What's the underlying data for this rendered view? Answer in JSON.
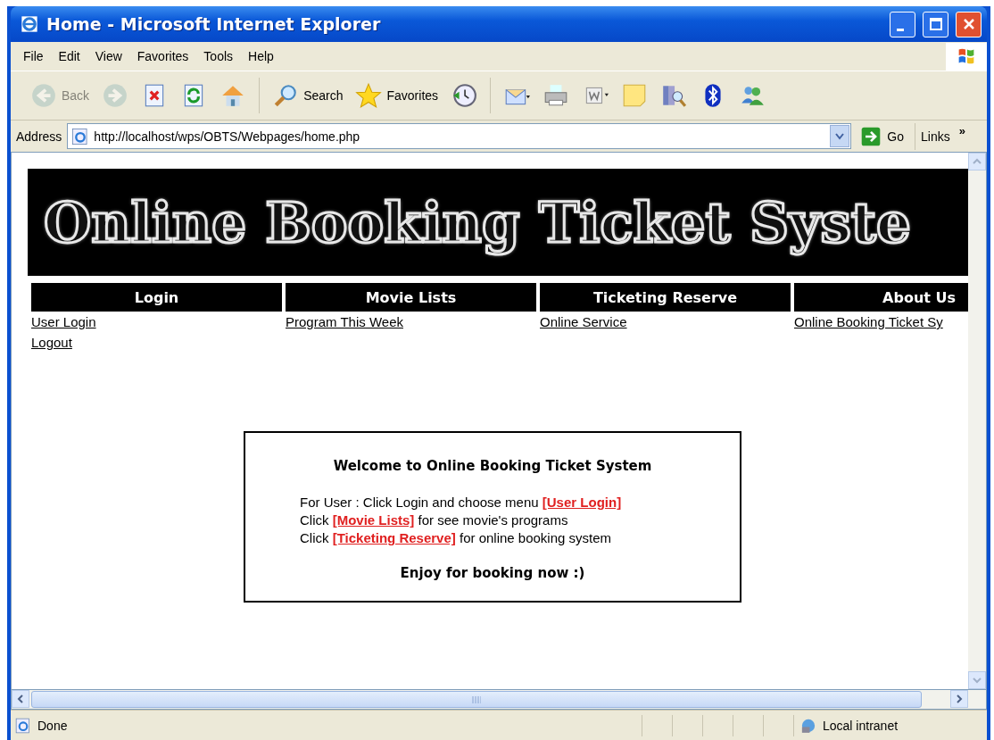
{
  "window": {
    "title": "Home - Microsoft Internet Explorer"
  },
  "menu": [
    "File",
    "Edit",
    "View",
    "Favorites",
    "Tools",
    "Help"
  ],
  "toolbar": [
    {
      "kind": "back",
      "label": "Back",
      "disabled": true
    },
    {
      "kind": "forward",
      "disabled": true
    },
    {
      "kind": "stop",
      "disabled": false
    },
    {
      "kind": "refresh",
      "disabled": false
    },
    {
      "kind": "home",
      "disabled": false
    },
    {
      "kind": "search",
      "label": "Search",
      "disabled": false
    },
    {
      "kind": "favorites",
      "label": "Favorites",
      "disabled": false
    },
    {
      "kind": "history",
      "disabled": false
    },
    {
      "kind": "mail",
      "disabled": false
    },
    {
      "kind": "print",
      "disabled": false
    },
    {
      "kind": "word",
      "disabled": false
    },
    {
      "kind": "note",
      "disabled": false
    },
    {
      "kind": "research",
      "disabled": false
    },
    {
      "kind": "bluetooth",
      "disabled": false
    },
    {
      "kind": "messenger",
      "disabled": false
    }
  ],
  "address": {
    "label": "Address",
    "url": "http://localhost/wps/OBTS/Webpages/home.php",
    "go": "Go",
    "links": "Links",
    "more": "»"
  },
  "page": {
    "banner": "Online Booking Ticket Syste",
    "nav": [
      {
        "heading": "Login",
        "links": [
          "User Login",
          "Logout"
        ]
      },
      {
        "heading": "Movie Lists",
        "links": [
          "Program This Week"
        ]
      },
      {
        "heading": "Ticketing Reserve",
        "links": [
          "Online Service"
        ]
      },
      {
        "heading": "About Us",
        "links": [
          "Online Booking Ticket Sy"
        ]
      }
    ],
    "welcome": {
      "title": "Welcome to Online Booking Ticket System",
      "lines": [
        {
          "before": "For User : Click Login and choose menu ",
          "link": "[User Login]"
        },
        {
          "before": "Click ",
          "link": "[Movie Lists]",
          "after": " for see movie's programs"
        },
        {
          "before": "Click ",
          "link": "[Ticketing Reserve]",
          "after": " for online booking system"
        }
      ],
      "closing": "Enjoy for booking now :)"
    }
  },
  "status": {
    "text": "Done",
    "zone": "Local intranet"
  }
}
